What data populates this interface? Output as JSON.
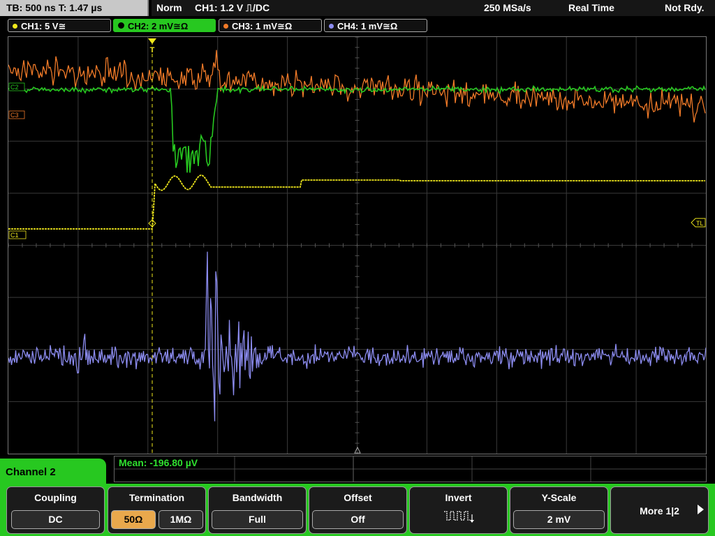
{
  "topbar": {
    "timebase": "TB: 500 ns   T: 1.47 µs",
    "mode": "Norm",
    "trigger": "CH1: 1.2 V ⎍/DC",
    "sample_rate": "250 MSa/s",
    "acq_mode": "Real Time",
    "status": "Not Rdy."
  },
  "channels": [
    {
      "label": "CH1: 5 V≅",
      "color": "#f0e81c"
    },
    {
      "label": "CH2: 2 mV≅Ω",
      "color": "#27c820"
    },
    {
      "label": "CH3: 1 mV≅Ω",
      "color": "#f07a28"
    },
    {
      "label": "CH4: 1 mV≅Ω",
      "color": "#8c8cf0"
    }
  ],
  "markers": {
    "c1": "C1",
    "c2": "C2",
    "c3": "C3",
    "tl": "TL",
    "trig": "T"
  },
  "measurement": {
    "text": "Mean: -196.80 µV"
  },
  "menu": {
    "channel_label": "Channel 2",
    "coupling": {
      "title": "Coupling",
      "value": "DC"
    },
    "termination": {
      "title": "Termination",
      "opt1": "50Ω",
      "opt2": "1MΩ"
    },
    "bandwidth": {
      "title": "Bandwidth",
      "value": "Full"
    },
    "offset": {
      "title": "Offset",
      "value": "Off"
    },
    "invert": {
      "title": "Invert",
      "icon": "invert-square-wave-icon"
    },
    "yscale": {
      "title": "Y-Scale",
      "value": "2 mV"
    },
    "more": {
      "title": "More 1|2"
    }
  }
}
